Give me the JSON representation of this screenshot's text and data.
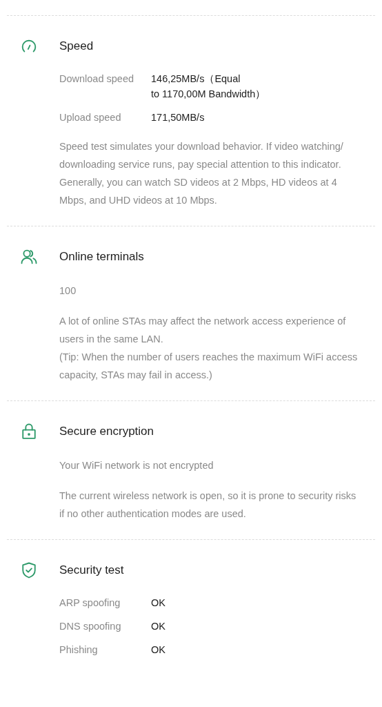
{
  "sections": [
    {
      "kind": "speed",
      "title": "Speed",
      "items": [
        {
          "kind": "rows",
          "rows": [
            {
              "label": "Download speed",
              "value": "146,25MB/s（Equal\nto 1170,00M Bandwidth）"
            },
            {
              "label": "Upload speed",
              "value": "171,50MB/s"
            }
          ]
        },
        {
          "kind": "text",
          "text": "Speed test simulates your download behavior. If video watching/ downloading service runs, pay special attention to this indicator. Generally, you can watch SD videos at 2 Mbps, HD videos at 4 Mbps, and UHD videos at 10 Mbps."
        }
      ]
    },
    {
      "kind": "terminals",
      "title": "Online terminals",
      "items": [
        {
          "kind": "text",
          "text": "100"
        },
        {
          "kind": "text",
          "text": "A lot of online STAs may affect the network access experience of users in the same LAN.\n(Tip: When the number of users reaches the maximum WiFi access capacity, STAs may fail in access.)"
        }
      ]
    },
    {
      "kind": "encryption",
      "title": "Secure encryption",
      "items": [
        {
          "kind": "text",
          "text": "Your WiFi network is not encrypted"
        },
        {
          "kind": "text",
          "text": "The current wireless network is open, so it is prone to security risks if no other authentication modes are used."
        }
      ]
    },
    {
      "kind": "security",
      "title": "Security test",
      "items": [
        {
          "kind": "rows",
          "rows": [
            {
              "label": "ARP spoofing",
              "value": "OK"
            },
            {
              "label": "DNS spoofing",
              "value": "OK"
            },
            {
              "label": "Phishing",
              "value": "OK"
            }
          ]
        }
      ]
    }
  ]
}
